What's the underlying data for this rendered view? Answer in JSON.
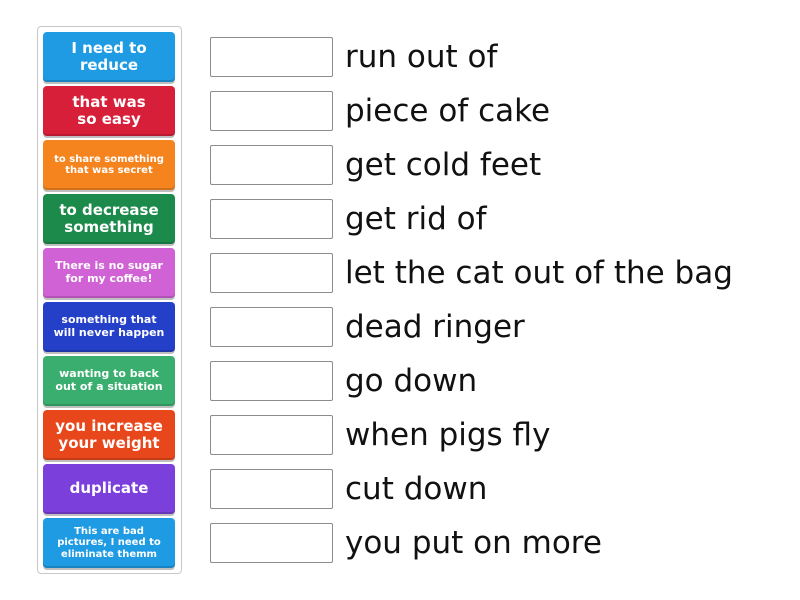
{
  "answer_tiles": [
    {
      "label": "I need to\nreduce",
      "color": "#1e9be3"
    },
    {
      "label": "that was\nso easy",
      "color": "#d81f3a"
    },
    {
      "label": "to share something\nthat was secret",
      "color": "#f5841f"
    },
    {
      "label": "to decrease\nsomething",
      "color": "#1c8a4a"
    },
    {
      "label": "There is no sugar\nfor my coffee!",
      "color": "#d062d6"
    },
    {
      "label": "something that\nwill never happen",
      "color": "#2540c8"
    },
    {
      "label": "wanting to back\nout of a situation",
      "color": "#3aae6e"
    },
    {
      "label": "you increase\nyour weight",
      "color": "#e8471c"
    },
    {
      "label": "duplicate",
      "color": "#7b3fdc"
    },
    {
      "label": "This are bad\npictures, I need to\neliminate themm",
      "color": "#1e9be3"
    }
  ],
  "phrases": [
    "run out of",
    "piece of cake",
    "get cold feet",
    "get rid of",
    "let the cat out of the bag",
    "dead ringer",
    "go down",
    "when pigs fly",
    "cut down",
    "you put on more"
  ]
}
